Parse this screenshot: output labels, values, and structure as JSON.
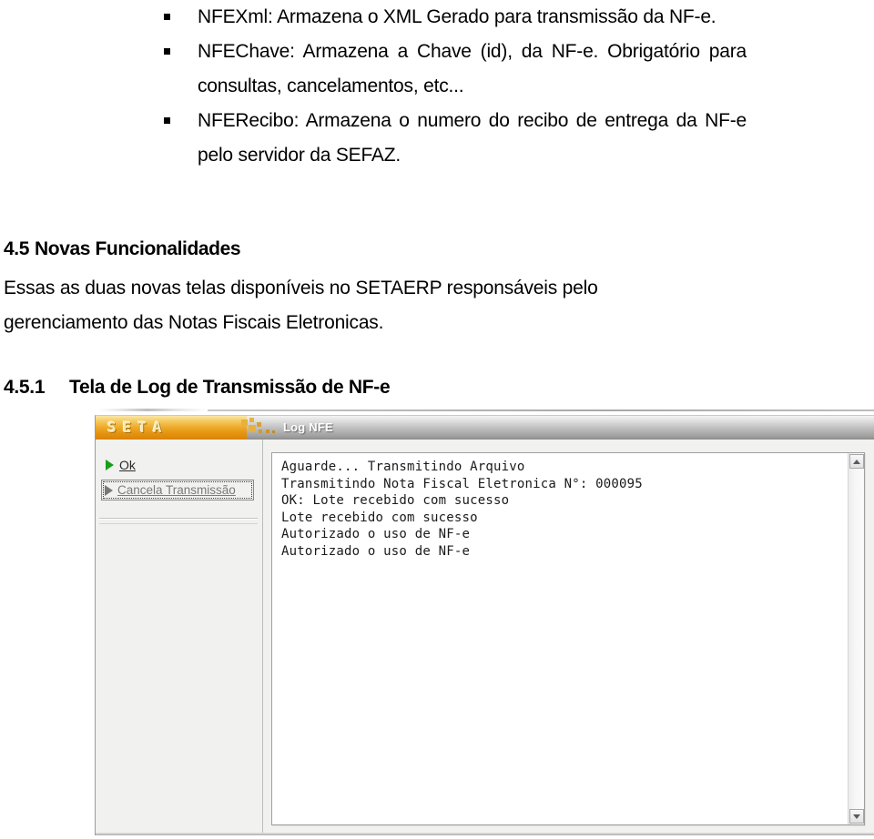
{
  "document": {
    "bullets": [
      "NFEXml: Armazena o XML Gerado para transmissão da NF-e.",
      "NFEChave: Armazena a Chave (id), da NF-e. Obrigatório para consultas, cancelamentos, etc...",
      "NFERecibo: Armazena o numero do recibo de entrega da NF-e pelo servidor da SEFAZ."
    ],
    "section_45": {
      "number": "4.5",
      "title": "Novas Funcionalidades"
    },
    "paragraph_line1": "Essas as duas novas telas disponíveis no SETAERP responsáveis pelo",
    "paragraph_line2": "gerenciamento das Notas Fiscais Eletronicas.",
    "section_451": {
      "number": "4.5.1",
      "title": "Tela de Log de Transmissão de NF-e"
    }
  },
  "app": {
    "titlebar": {
      "logo": "SETA",
      "title": "Log NFE",
      "gold_color": "#eeab2c",
      "gray_color": "#bcbcbc"
    },
    "sidebar": {
      "ok_button": "Ok",
      "cancel_button": "Cancela Transmissão"
    },
    "log": {
      "lines": [
        "Aguarde... Transmitindo Arquivo",
        "Transmitindo Nota Fiscal Eletronica N°: 000095",
        "OK: Lote recebido com sucesso",
        "Lote recebido com sucesso",
        "Autorizado o uso de NF-e",
        "Autorizado o uso de NF-e"
      ],
      "text": "Aguarde... Transmitindo Arquivo\nTransmitindo Nota Fiscal Eletronica N°: 000095\nOK: Lote recebido com sucesso\nLote recebido com sucesso\nAutorizado o uso de NF-e\nAutorizado o uso de NF-e"
    },
    "scrollbar": {
      "up_icon": "scroll-up-arrow-icon",
      "down_icon": "scroll-down-arrow-icon"
    }
  }
}
